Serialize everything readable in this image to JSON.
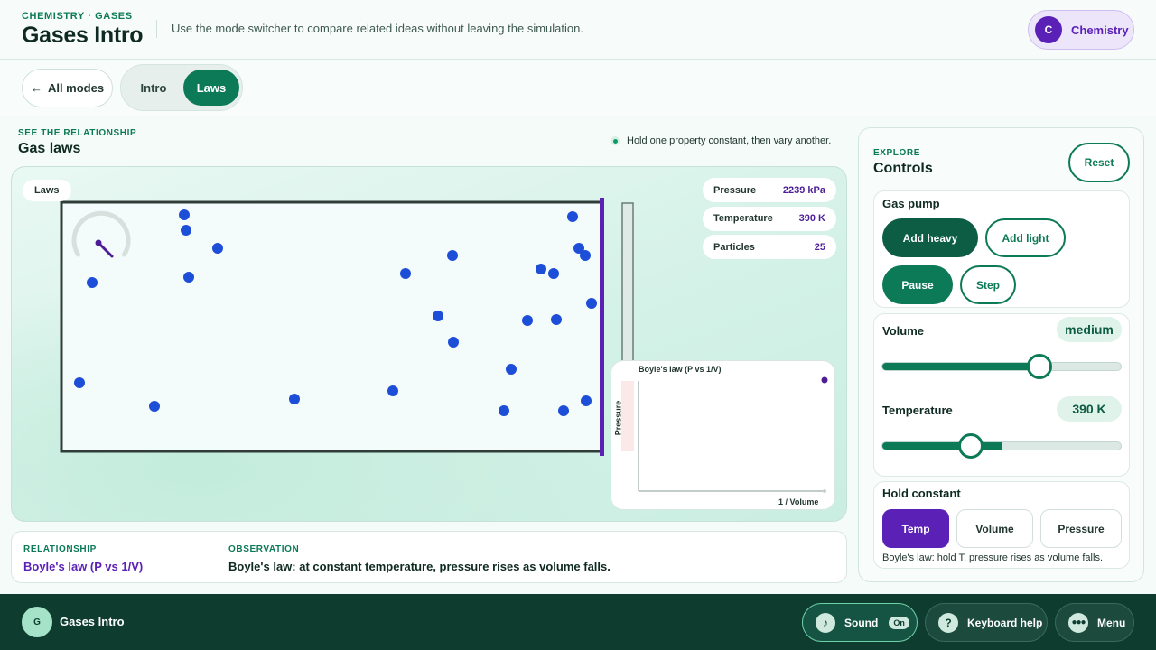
{
  "header": {
    "eyebrow": "CHEMISTRY · GASES",
    "title": "Gases Intro",
    "description": "Use the mode switcher to compare related ideas without leaving the simulation.",
    "subject": {
      "initial": "C",
      "label": "Chemistry"
    }
  },
  "modebar": {
    "all_modes": "All modes",
    "tabs": [
      {
        "label": "Intro",
        "active": false
      },
      {
        "label": "Laws",
        "active": true
      }
    ]
  },
  "main": {
    "eyebrow": "SEE THE RELATIONSHIP",
    "title": "Gas laws",
    "hint": "Hold one property constant, then vary another.",
    "stage_tag": "Laws"
  },
  "readouts": [
    {
      "label": "Pressure",
      "value": "2239 kPa"
    },
    {
      "label": "Temperature",
      "value": "390 K"
    },
    {
      "label": "Particles",
      "value": "25"
    }
  ],
  "simulation": {
    "particle_color": "#1d4ed8",
    "gauge_needle_color": "#4c1d95",
    "wall_color": "#5b21b6",
    "particles": [
      [
        203,
        237
      ],
      [
        205,
        254
      ],
      [
        240,
        274
      ],
      [
        208,
        306
      ],
      [
        101,
        312
      ],
      [
        87,
        423
      ],
      [
        170,
        449
      ],
      [
        325,
        441
      ],
      [
        448,
        302
      ],
      [
        500,
        282
      ],
      [
        484,
        349
      ],
      [
        501,
        378
      ],
      [
        434,
        432
      ],
      [
        565,
        408
      ],
      [
        557,
        454
      ],
      [
        598,
        297
      ],
      [
        612,
        302
      ],
      [
        583,
        354
      ],
      [
        615,
        353
      ],
      [
        633,
        239
      ],
      [
        640,
        274
      ],
      [
        647,
        282
      ],
      [
        654,
        335
      ],
      [
        648,
        443
      ],
      [
        623,
        454
      ]
    ]
  },
  "graph": {
    "title": "Boyle's law  (P vs 1/V)",
    "ylabel": "Pressure",
    "xlabel": "1 / Volume"
  },
  "relationship": {
    "label": "RELATIONSHIP",
    "value": "Boyle's law (P vs 1/V)",
    "observation_label": "OBSERVATION",
    "observation": "Boyle's law: at constant temperature, pressure rises as volume falls."
  },
  "controls": {
    "eyebrow": "EXPLORE",
    "title": "Controls",
    "reset": "Reset",
    "gas_pump": {
      "title": "Gas pump",
      "add_heavy": "Add heavy",
      "add_light": "Add light",
      "pause": "Pause",
      "step": "Step"
    },
    "volume": {
      "label": "Volume",
      "value": "medium",
      "fraction": 0.66
    },
    "temperature": {
      "label": "Temperature",
      "value": "390 K",
      "fraction": 0.37
    },
    "hold_constant": {
      "title": "Hold constant",
      "options": [
        {
          "label": "Temp",
          "active": true
        },
        {
          "label": "Volume",
          "active": false
        },
        {
          "label": "Pressure",
          "active": false
        }
      ],
      "caption": "Boyle's law: hold T; pressure rises as volume falls."
    }
  },
  "footer": {
    "initial": "G",
    "title": "Gases Intro",
    "sound": {
      "icon": "music-note-icon",
      "label": "Sound",
      "state": "On"
    },
    "keyboard_help": {
      "icon": "question-icon",
      "label": "Keyboard help"
    },
    "menu": {
      "icon": "ellipsis-icon",
      "label": "Menu"
    }
  },
  "colors": {
    "accent": "#0d7a57",
    "purple": "#5b21b6",
    "footer": "#0e3d30"
  }
}
